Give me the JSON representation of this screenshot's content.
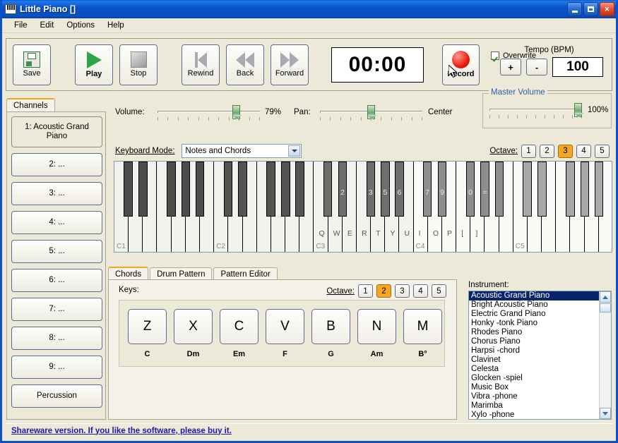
{
  "window": {
    "title": "Little Piano []",
    "icon": "piano-keys-icon",
    "minimize": "minimize-icon",
    "maximize": "maximize-icon",
    "close": "close-icon"
  },
  "menu": {
    "items": [
      "File",
      "Edit",
      "Options",
      "Help"
    ]
  },
  "toolbar": {
    "save": "Save",
    "play": "Play",
    "stop": "Stop",
    "rewind": "Rewind",
    "back": "Back",
    "forward": "Forward",
    "time": "00:00",
    "record": "Record",
    "overwrite_label": "Overwrite",
    "overwrite_checked": true,
    "tempo_label": "Tempo (BPM)",
    "tempo_plus": "+",
    "tempo_minus": "-",
    "tempo_value": "100"
  },
  "mixer": {
    "volume_label": "Volume:",
    "volume_value": "79%",
    "volume_pct": 79,
    "pan_label": "Pan:",
    "pan_value": "Center",
    "pan_pct": 50,
    "master_group": "Master Volume",
    "master_value": "100%",
    "master_pct": 100
  },
  "channels": {
    "tab": "Channels",
    "selected_index": 0,
    "items": [
      "1: Acoustic Grand Piano",
      "2: ...",
      "3: ...",
      "4: ...",
      "5: ...",
      "6: ...",
      "7: ...",
      "8: ...",
      "9: ...",
      "Percussion"
    ]
  },
  "keyboard": {
    "mode_label": "Keyboard Mode:",
    "mode_value": "Notes and Chords",
    "octave_label": "Octave:",
    "octaves": [
      "1",
      "2",
      "3",
      "4",
      "5"
    ],
    "octave_selected": "3",
    "c_labels": [
      "C1",
      "C2",
      "C3",
      "C4",
      "C5"
    ],
    "white_keys": [
      "Q",
      "W",
      "E",
      "R",
      "T",
      "Y",
      "U",
      "I",
      "O",
      "P",
      "[",
      "]"
    ],
    "black_keys": [
      "2",
      "3",
      "5",
      "6",
      "7",
      "9",
      "0",
      "="
    ]
  },
  "lower_tabs": {
    "items": [
      "Chords",
      "Drum Pattern",
      "Pattern Editor"
    ],
    "selected": "Chords"
  },
  "chords": {
    "keys_label": "Keys:",
    "octave_label": "Octave:",
    "octaves": [
      "1",
      "2",
      "3",
      "4",
      "5"
    ],
    "octave_selected": "2",
    "buttons": [
      {
        "key": "Z",
        "chord": "C"
      },
      {
        "key": "X",
        "chord": "Dm"
      },
      {
        "key": "C",
        "chord": "Em"
      },
      {
        "key": "V",
        "chord": "F"
      },
      {
        "key": "B",
        "chord": "G"
      },
      {
        "key": "N",
        "chord": "Am"
      },
      {
        "key": "M",
        "chord": "B°"
      }
    ]
  },
  "instrument": {
    "label": "Instrument:",
    "selected": "Acoustic Grand Piano",
    "items": [
      "Acoustic Grand Piano",
      "Bright Acoustic Piano",
      "Electric Grand Piano",
      "Honky -tonk Piano",
      "Rhodes Piano",
      "Chorus Piano",
      "Harpsi -chord",
      "Clavinet",
      "Celesta",
      "Glocken -spiel",
      "Music Box",
      "Vibra -phone",
      "Marimba",
      "Xylo -phone"
    ],
    "scroll_up": "scroll-up-icon",
    "scroll_down": "scroll-down-icon"
  },
  "status": {
    "text": "Shareware version. If you like the software, please buy it."
  },
  "colors": {
    "titlebar": "#0a53c8",
    "accent_orange": "#f5a623",
    "face": "#ece9d8",
    "selection_blue": "#0a246a",
    "link_blue": "#1a1aa8",
    "group_label": "#2c5fa8"
  }
}
